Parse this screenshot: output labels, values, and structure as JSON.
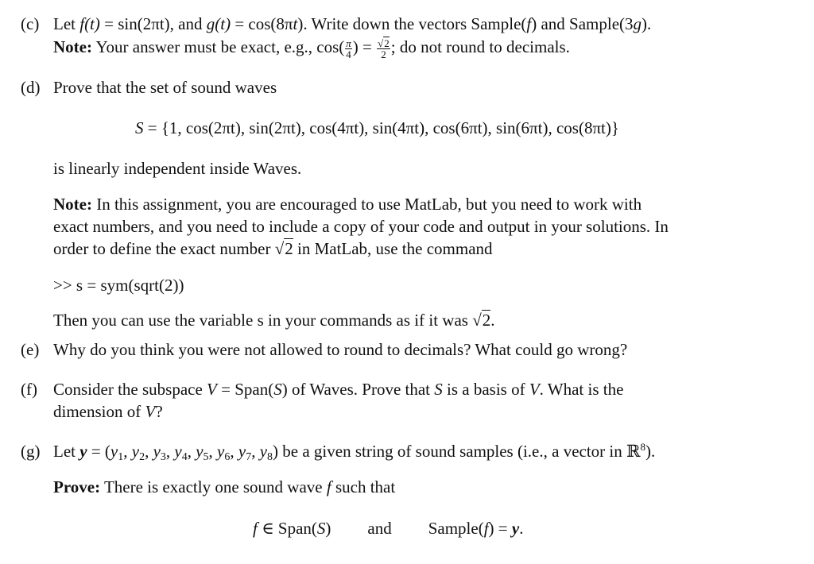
{
  "parts": {
    "c": {
      "label": "(c)",
      "line1": {
        "let": "Let ",
        "f_t": "f(t)",
        "eq1": " = sin(2πt), and ",
        "g_t": "g(t)",
        "eq2": " = cos(8π",
        "t": "t",
        "tail": "). Write down the vectors Sample(",
        "f": "f",
        "mid": ") and Sample(3",
        "g": "g",
        "end": ")."
      },
      "note_label": "Note:",
      "note_text": " Your answer must be exact, e.g., cos(",
      "frac_num": "π",
      "frac_den": "4",
      "note_eq": ") = ",
      "sqrt_num_symbol": "√",
      "sqrt_num_value": "2",
      "sqrt_den": "2",
      "note_end": "; do not round to decimals."
    },
    "d": {
      "label": "(d)",
      "intro": "Prove that the set of sound waves",
      "set_name": "S",
      "set_expr": " = {1, cos(2πt), sin(2πt), cos(4πt), sin(4πt), cos(6πt), sin(6πt), cos(8πt)}",
      "conclusion": "is linearly independent inside Waves.",
      "note_label": "Note:",
      "note_line1": " In this assignment, you are encouraged to use MatLab, but you need to work with",
      "note_line2": "exact numbers, and you need to include a copy of your code and output in your solutions. In",
      "note_line3_a": "order to define the exact number ",
      "sqrt_symbol": "√",
      "sqrt_value": "2",
      "note_line3_b": " in MatLab, use the command",
      "command": ">> s = sym(sqrt(2))",
      "after_a": "Then you can use the variable s in your commands as if it was ",
      "after_sqrt_value": "2",
      "after_b": "."
    },
    "e": {
      "label": "(e)",
      "text": "Why do you think you were not allowed to round to decimals? What could go wrong?"
    },
    "f": {
      "label": "(f)",
      "line1_a": "Consider the subspace ",
      "V": "V",
      "line1_b": " = Span(",
      "S": "S",
      "line1_c": ") of Waves. Prove that ",
      "line1_d": " is a basis of ",
      "line1_e": ". What is the",
      "line2_a": "dimension of ",
      "line2_b": "?"
    },
    "g": {
      "label": "(g)",
      "let": "Let ",
      "y": "y",
      "eq": " = (",
      "components": [
        "1",
        "2",
        "3",
        "4",
        "5",
        "6",
        "7",
        "8"
      ],
      "tail": ") be a given string of sound samples (i.e., a vector in ℝ",
      "exp": "8",
      "tail_end": ").",
      "prove_label": "Prove:",
      "prove_text": " There is exactly one sound wave ",
      "f": "f",
      "prove_end": " such that",
      "cond1_a": " ∈ Span(",
      "cond1_S": "S",
      "cond1_b": ")",
      "and": "and",
      "cond2_a": "Sample(",
      "cond2_b": ") = ",
      "cond2_end": "."
    }
  }
}
